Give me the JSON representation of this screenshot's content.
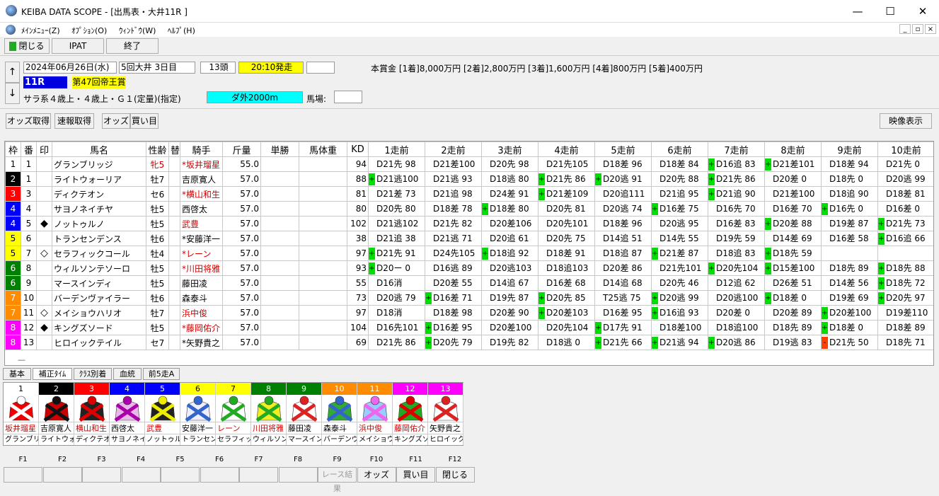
{
  "window": {
    "title": "KEIBA DATA SCOPE - [出馬表・大井11R ]",
    "minimize": "—",
    "maximize": "☐",
    "close": "✕"
  },
  "menu": [
    "ﾒｲﾝﾒﾆｭｰ(Z)",
    "ｵﾌﾟｼｮﾝ(O)",
    "ｳｨﾝﾄﾞｳ(W)",
    "ﾍﾙﾌﾟ(H)"
  ],
  "toolbar": {
    "close": "閉じる",
    "ipat": "IPAT",
    "exit": "終了"
  },
  "race": {
    "date": "2024年06月26日(水)",
    "meeting": "5回大井 3日目",
    "count": "13頭",
    "start": "20:10発走",
    "blank": "",
    "prize": "本賞金 [1着]8,000万円 [2着]2,800万円 [3着]1,600万円 [4着]800万円 [5着]400万円",
    "rnum": "11R",
    "name": "第47回帝王賞",
    "cond": "サラ系４歳上・４歳上・Ｇ１(定量)(指定)",
    "course": "ダ外2000m",
    "baba_label": "馬場:",
    "baba": ""
  },
  "arrows": {
    "up": "↑",
    "down": "↓"
  },
  "actions": {
    "odds": "オッズ取得",
    "sokuho": "速報取得",
    "odds2": "オッズ",
    "kaime": "買い目",
    "video": "映像表示"
  },
  "headers": [
    "枠",
    "番",
    "印",
    "馬名",
    "性齢",
    "替",
    "騎手",
    "斤量",
    "単勝",
    "馬体重",
    "KD",
    "1走前",
    "2走前",
    "3走前",
    "4走前",
    "5走前",
    "6走前",
    "7走前",
    "8走前",
    "9走前",
    "10走前"
  ],
  "rows": [
    {
      "waku": "1",
      "wc": "#ffffff",
      "wt": "#000",
      "ban": "1",
      "mark": "",
      "name": "グランブリッジ",
      "sexage": "牝5",
      "sexred": true,
      "kae": "",
      "jockey": "*坂井瑠星",
      "jred": true,
      "kin": "55.0",
      "kd": "94",
      "runs": [
        [
          "",
          "D21先 98"
        ],
        [
          "",
          "D21差100"
        ],
        [
          "",
          "D20先 98"
        ],
        [
          "",
          "D21先105"
        ],
        [
          "",
          "D18差 96"
        ],
        [
          "",
          "D18差 84"
        ],
        [
          "+",
          "D16追 83"
        ],
        [
          "+",
          "D21差101"
        ],
        [
          "",
          "D18差 94"
        ],
        [
          "",
          "D21先  0"
        ]
      ]
    },
    {
      "waku": "2",
      "wc": "#000000",
      "wt": "#fff",
      "ban": "1",
      "mark": "",
      "name": "ライトウォーリア",
      "sexage": "牡7",
      "sexred": false,
      "kae": "",
      "jockey": "吉原寛人",
      "jred": false,
      "kin": "57.0",
      "kd": "88",
      "runs": [
        [
          "+",
          "D21逃100"
        ],
        [
          "",
          "D21逃 93"
        ],
        [
          "",
          "D18逃 80"
        ],
        [
          "+",
          "D21先 86"
        ],
        [
          "+",
          "D20逃 91"
        ],
        [
          "",
          "D20先 88"
        ],
        [
          "+",
          "D21先 86"
        ],
        [
          "",
          "D20差  0"
        ],
        [
          "",
          "D18先  0"
        ],
        [
          "",
          "D20逃 99"
        ]
      ]
    },
    {
      "waku": "3",
      "wc": "#ff0000",
      "wt": "#fff",
      "ban": "3",
      "mark": "",
      "name": "ディクテオン",
      "sexage": "セ6",
      "sexred": false,
      "kae": "",
      "jockey": "*横山和生",
      "jred": true,
      "kin": "57.0",
      "kd": "81",
      "runs": [
        [
          "",
          "D21差 73"
        ],
        [
          "",
          "D21追 98"
        ],
        [
          "",
          "D24差 91"
        ],
        [
          "+",
          "D21差109"
        ],
        [
          "",
          "D20追111"
        ],
        [
          "",
          "D21追 95"
        ],
        [
          "+",
          "D21追 90"
        ],
        [
          "",
          "D21差100"
        ],
        [
          "",
          "D18追 90"
        ],
        [
          "",
          "D18差 81"
        ]
      ]
    },
    {
      "waku": "4",
      "wc": "#0000ff",
      "wt": "#fff",
      "ban": "4",
      "mark": "",
      "name": "サヨノネイチヤ",
      "sexage": "牡5",
      "sexred": false,
      "kae": "",
      "jockey": "西啓太",
      "jred": false,
      "kin": "57.0",
      "kd": "80",
      "runs": [
        [
          "",
          "D20先 80"
        ],
        [
          "",
          "D18差 78"
        ],
        [
          "+",
          "D18差 80"
        ],
        [
          "",
          "D20先 81"
        ],
        [
          "",
          "D20逃 74"
        ],
        [
          "+",
          "D16差 75"
        ],
        [
          "",
          "D16先 70"
        ],
        [
          "",
          "D16差 70"
        ],
        [
          "+",
          "D16先  0"
        ],
        [
          "",
          "D16差  0"
        ]
      ]
    },
    {
      "waku": "4",
      "wc": "#0000ff",
      "wt": "#fff",
      "ban": "5",
      "mark": "◆",
      "name": "ノットゥルノ",
      "sexage": "牡5",
      "sexred": false,
      "kae": "",
      "jockey": "武豊",
      "jred": true,
      "kin": "57.0",
      "kd": "102",
      "runs": [
        [
          "",
          "D21逃102"
        ],
        [
          "",
          "D21先 82"
        ],
        [
          "",
          "D20差106"
        ],
        [
          "",
          "D20先101"
        ],
        [
          "",
          "D18差 96"
        ],
        [
          "",
          "D20逃 95"
        ],
        [
          "",
          "D16差 83"
        ],
        [
          "+",
          "D20差 88"
        ],
        [
          "",
          "D19差 87"
        ],
        [
          "+",
          "D21先 73"
        ]
      ]
    },
    {
      "waku": "5",
      "wc": "#ffff00",
      "wt": "#000",
      "ban": "6",
      "mark": "",
      "name": "トランセンデンス",
      "sexage": "牡6",
      "sexred": false,
      "kae": "",
      "jockey": "*安藤洋一",
      "jred": false,
      "kin": "57.0",
      "kd": "38",
      "runs": [
        [
          "",
          "D21追 38"
        ],
        [
          "",
          "D21逃 71"
        ],
        [
          "",
          "D20追 61"
        ],
        [
          "",
          "D20先 75"
        ],
        [
          "",
          "D14追 51"
        ],
        [
          "",
          "D14先 55"
        ],
        [
          "",
          "D19先 59"
        ],
        [
          "",
          "D14差 69"
        ],
        [
          "",
          "D16差 58"
        ],
        [
          "+",
          "D16追 66"
        ]
      ]
    },
    {
      "waku": "5",
      "wc": "#ffff00",
      "wt": "#000",
      "ban": "7",
      "mark": "◇",
      "name": "セラフィックコール",
      "sexage": "牡4",
      "sexred": false,
      "kae": "",
      "jockey": "*レーン",
      "jred": true,
      "kin": "57.0",
      "kd": "97",
      "runs": [
        [
          "+",
          "D21先 91"
        ],
        [
          "",
          "D24先105"
        ],
        [
          "+",
          "D18追 92"
        ],
        [
          "",
          "D18差 91"
        ],
        [
          "",
          "D18追 87"
        ],
        [
          "+",
          "D21差 87"
        ],
        [
          "",
          "D18追 83"
        ],
        [
          "+",
          "D18先 59"
        ],
        [
          "",
          ""
        ],
        [
          "",
          ""
        ]
      ]
    },
    {
      "waku": "6",
      "wc": "#008000",
      "wt": "#fff",
      "ban": "8",
      "mark": "",
      "name": "ウィルソンテソーロ",
      "sexage": "牡5",
      "sexred": false,
      "kae": "",
      "jockey": "*川田将雅",
      "jred": true,
      "kin": "57.0",
      "kd": "93",
      "runs": [
        [
          "+",
          "D20ー  0"
        ],
        [
          "",
          "D16逃 89"
        ],
        [
          "",
          "D20逃103"
        ],
        [
          "",
          "D18追103"
        ],
        [
          "",
          "D20差 86"
        ],
        [
          "",
          "D21先101"
        ],
        [
          "+",
          "D20先104"
        ],
        [
          "+",
          "D15差100"
        ],
        [
          "",
          "D18先 89"
        ],
        [
          "+",
          "D18先 88"
        ]
      ]
    },
    {
      "waku": "6",
      "wc": "#008000",
      "wt": "#fff",
      "ban": "9",
      "mark": "",
      "name": "マースインディ",
      "sexage": "牡5",
      "sexred": false,
      "kae": "",
      "jockey": "藤田凌",
      "jred": false,
      "kin": "57.0",
      "kd": "55",
      "runs": [
        [
          "",
          "D16消"
        ],
        [
          "",
          "D20差 55"
        ],
        [
          "",
          "D14追 67"
        ],
        [
          "",
          "D16差 68"
        ],
        [
          "",
          "D14追 68"
        ],
        [
          "",
          "D20先 46"
        ],
        [
          "",
          "D12追 62"
        ],
        [
          "",
          "D26差 51"
        ],
        [
          "",
          "D14差 56"
        ],
        [
          "+",
          "D18先 72"
        ]
      ]
    },
    {
      "waku": "7",
      "wc": "#ff8c00",
      "wt": "#fff",
      "ban": "10",
      "mark": "",
      "name": "バーデンヴァイラー",
      "sexage": "牡6",
      "sexred": false,
      "kae": "",
      "jockey": "森泰斗",
      "jred": false,
      "kin": "57.0",
      "kd": "73",
      "runs": [
        [
          "",
          "D20逃 79"
        ],
        [
          "+",
          "D16差 71"
        ],
        [
          "",
          "D19先 87"
        ],
        [
          "+",
          "D20先 85"
        ],
        [
          "",
          "T25逃 75"
        ],
        [
          "+",
          "D20逃 99"
        ],
        [
          "",
          "D20逃100"
        ],
        [
          "+",
          "D18差  0"
        ],
        [
          "",
          "D19差 69"
        ],
        [
          "+",
          "D20先 97"
        ]
      ]
    },
    {
      "waku": "7",
      "wc": "#ff8c00",
      "wt": "#fff",
      "ban": "11",
      "mark": "◇",
      "name": "メイショウハリオ",
      "sexage": "牡7",
      "sexred": false,
      "kae": "",
      "jockey": "浜中俊",
      "jred": true,
      "kin": "57.0",
      "kd": "97",
      "runs": [
        [
          "",
          "D18消"
        ],
        [
          "",
          "D18差 98"
        ],
        [
          "",
          "D20差 90"
        ],
        [
          "+",
          "D20差103"
        ],
        [
          "",
          "D16差 95"
        ],
        [
          "+",
          "D16追 93"
        ],
        [
          "",
          "D20差  0"
        ],
        [
          "",
          "D20差 89"
        ],
        [
          "+",
          "D20差100"
        ],
        [
          "",
          "D19差110"
        ]
      ]
    },
    {
      "waku": "8",
      "wc": "#ff00ff",
      "wt": "#fff",
      "ban": "12",
      "mark": "◆",
      "name": "キングズソード",
      "sexage": "牡5",
      "sexred": false,
      "kae": "",
      "jockey": "*藤岡佑介",
      "jred": true,
      "kin": "57.0",
      "kd": "104",
      "runs": [
        [
          "",
          "D16先101"
        ],
        [
          "+",
          "D16差 95"
        ],
        [
          "",
          "D20差100"
        ],
        [
          "",
          "D20先104"
        ],
        [
          "+",
          "D17先 91"
        ],
        [
          "",
          "D18差100"
        ],
        [
          "",
          "D18追100"
        ],
        [
          "",
          "D18先 89"
        ],
        [
          "+",
          "D18差  0"
        ],
        [
          "",
          "D18差 89"
        ]
      ]
    },
    {
      "waku": "8",
      "wc": "#ff00ff",
      "wt": "#fff",
      "ban": "13",
      "mark": "",
      "name": "ヒロイックテイル",
      "sexage": "セ7",
      "sexred": false,
      "kae": "",
      "jockey": "*矢野貴之",
      "jred": false,
      "kin": "57.0",
      "kd": "69",
      "runs": [
        [
          "",
          "D21先 86"
        ],
        [
          "+",
          "D20先 79"
        ],
        [
          "",
          "D19先 82"
        ],
        [
          "",
          "D18逃  0"
        ],
        [
          "+",
          "D21先 66"
        ],
        [
          "+",
          "D21逃 94"
        ],
        [
          "+",
          "D20逃 86"
        ],
        [
          "",
          "D19逃 83"
        ],
        [
          "-",
          "D21先 50"
        ],
        [
          "",
          "D18先 71"
        ]
      ]
    }
  ],
  "rowdash": "—",
  "tabs": [
    "基本",
    "補正ﾀｲﾑ",
    "ｸﾗｽ別着",
    "血統",
    "前5走A"
  ],
  "silks": [
    {
      "n": "1",
      "bg": "#ffffff",
      "fg": "#000",
      "jockey": "坂井瑠星",
      "red": true,
      "horse": "グランブリッジ",
      "c1": "#e00",
      "c2": "#fff"
    },
    {
      "n": "2",
      "bg": "#000000",
      "fg": "#fff",
      "jockey": "吉原寛人",
      "red": false,
      "horse": "ライトウォーリア",
      "c1": "#c00",
      "c2": "#111"
    },
    {
      "n": "3",
      "bg": "#ff0000",
      "fg": "#fff",
      "jockey": "横山和生",
      "red": true,
      "horse": "ディクテオン",
      "c1": "#222",
      "c2": "#d00"
    },
    {
      "n": "4",
      "bg": "#0000ff",
      "fg": "#fff",
      "jockey": "西啓太",
      "red": false,
      "horse": "サヨノネイチヤ",
      "c1": "#e9b8e9",
      "c2": "#a0a"
    },
    {
      "n": "5",
      "bg": "#0000ff",
      "fg": "#fff",
      "jockey": "武豊",
      "red": true,
      "horse": "ノットゥルノ",
      "c1": "#222",
      "c2": "#ee0"
    },
    {
      "n": "6",
      "bg": "#ffff00",
      "fg": "#000",
      "jockey": "安藤洋一",
      "red": false,
      "horse": "トランセンデンス",
      "c1": "#eef",
      "c2": "#36c"
    },
    {
      "n": "7",
      "bg": "#ffff00",
      "fg": "#000",
      "jockey": "レーン",
      "red": true,
      "horse": "セラフィックコール",
      "c1": "#fff",
      "c2": "#2a2"
    },
    {
      "n": "8",
      "bg": "#008000",
      "fg": "#fff",
      "jockey": "川田将雅",
      "red": true,
      "horse": "ウィルソンテソーロ",
      "c1": "#ee2",
      "c2": "#2a2"
    },
    {
      "n": "9",
      "bg": "#008000",
      "fg": "#fff",
      "jockey": "藤田凌",
      "red": false,
      "horse": "マースインディ",
      "c1": "#fff",
      "c2": "#d22"
    },
    {
      "n": "10",
      "bg": "#ff8c00",
      "fg": "#fff",
      "jockey": "森泰斗",
      "red": false,
      "horse": "バーデンヴァイラー",
      "c1": "#3a3",
      "c2": "#36c"
    },
    {
      "n": "11",
      "bg": "#ff8c00",
      "fg": "#fff",
      "jockey": "浜中俊",
      "red": true,
      "horse": "メイショウハリオ",
      "c1": "#9cf",
      "c2": "#e6e"
    },
    {
      "n": "12",
      "bg": "#ff00ff",
      "fg": "#fff",
      "jockey": "藤岡佑介",
      "red": true,
      "horse": "キングズソード",
      "c1": "#2a2",
      "c2": "#d00"
    },
    {
      "n": "13",
      "bg": "#ff00ff",
      "fg": "#fff",
      "jockey": "矢野貴之",
      "red": false,
      "horse": "ヒロイックテイル",
      "c1": "#fff",
      "c2": "#d22"
    }
  ],
  "fkeys": [
    "F1",
    "F2",
    "F3",
    "F4",
    "F5",
    "F6",
    "F7",
    "F8",
    "F9",
    "F10",
    "F11",
    "F12"
  ],
  "fbuttons": [
    "",
    "",
    "",
    "",
    "",
    "",
    "",
    "",
    "レース結果",
    "オッズ",
    "買い目",
    "閉じる"
  ]
}
